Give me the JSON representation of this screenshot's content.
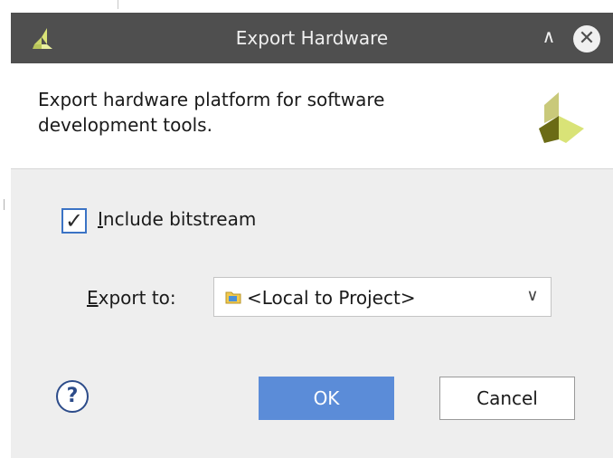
{
  "dialog": {
    "title": "Export Hardware",
    "description": "Export hardware platform for software development tools."
  },
  "form": {
    "include_bitstream": {
      "checked": true,
      "label_mnemonic": "I",
      "label_rest": "nclude bitstream"
    },
    "export_to": {
      "label_mnemonic": "E",
      "label_rest": "xport to:",
      "selected": "<Local to Project>"
    }
  },
  "buttons": {
    "help": "?",
    "ok": "OK",
    "cancel": "Cancel"
  },
  "colors": {
    "titlebar": "#4f4f4f",
    "ok_button": "#5b8cd8",
    "checkbox_border": "#3b73c5",
    "logo_dark": "#6b6b15",
    "logo_light": "#d9e377"
  }
}
